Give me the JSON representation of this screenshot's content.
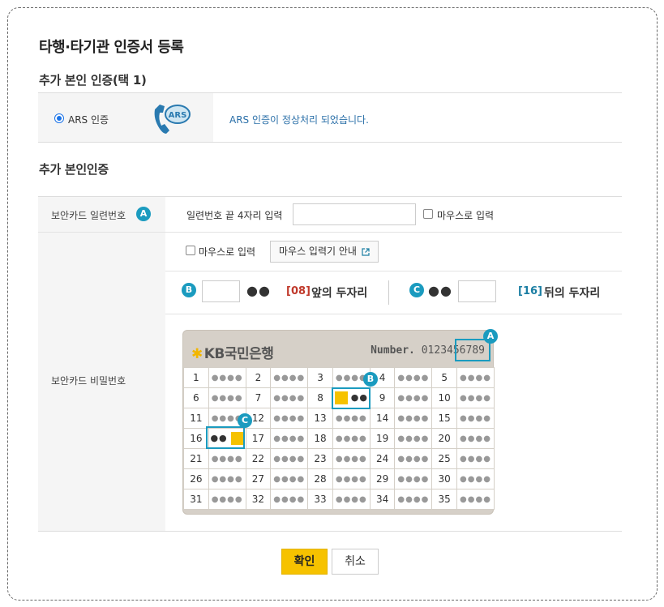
{
  "title": "타행·타기관 인증서 등록",
  "ars_section": {
    "heading": "추가 본인 인증(택 1)",
    "option_label": "ARS 인증",
    "icon_text": "ARS",
    "message": "ARS 인증이 정상처리 되었습니다."
  },
  "security_section": {
    "heading": "추가 본인인증",
    "serial_label": "보안카드 일련번호",
    "serial_badge": "A",
    "serial_prompt": "일련번호 끝 4자리 입력",
    "serial_value": "",
    "mouse_input_label": "마우스로 입력",
    "password_label": "보안카드 비밀번호",
    "mouse_input_label2": "마우스로 입력",
    "mouse_guide_button": "마우스 입력기 안내",
    "b_badge": "B",
    "b_dots": "●●",
    "b_index": "[08]",
    "b_desc": "앞의 두자리",
    "c_badge": "C",
    "c_dots": "●●",
    "c_index": "[16]",
    "c_desc": "뒤의 두자리"
  },
  "card": {
    "bank_name": "KB국민은행",
    "number_label": "Number.",
    "number_value": "0123456789",
    "badge_a": "A",
    "badge_b": "B",
    "badge_c": "C",
    "rows": [
      [
        1,
        2,
        3,
        4,
        5
      ],
      [
        6,
        7,
        8,
        9,
        10
      ],
      [
        11,
        12,
        13,
        14,
        15
      ],
      [
        16,
        17,
        18,
        19,
        20
      ],
      [
        21,
        22,
        23,
        24,
        25
      ],
      [
        26,
        27,
        28,
        29,
        30
      ],
      [
        31,
        32,
        33,
        34,
        35
      ]
    ],
    "mask": "●●●●",
    "b_mask": "●●",
    "c_mask": "●●"
  },
  "buttons": {
    "confirm": "확인",
    "cancel": "취소"
  },
  "colors": {
    "accent": "#f6c200",
    "badge": "#1b9bbf",
    "message": "#2a6fa8",
    "red": "#c0392b"
  }
}
